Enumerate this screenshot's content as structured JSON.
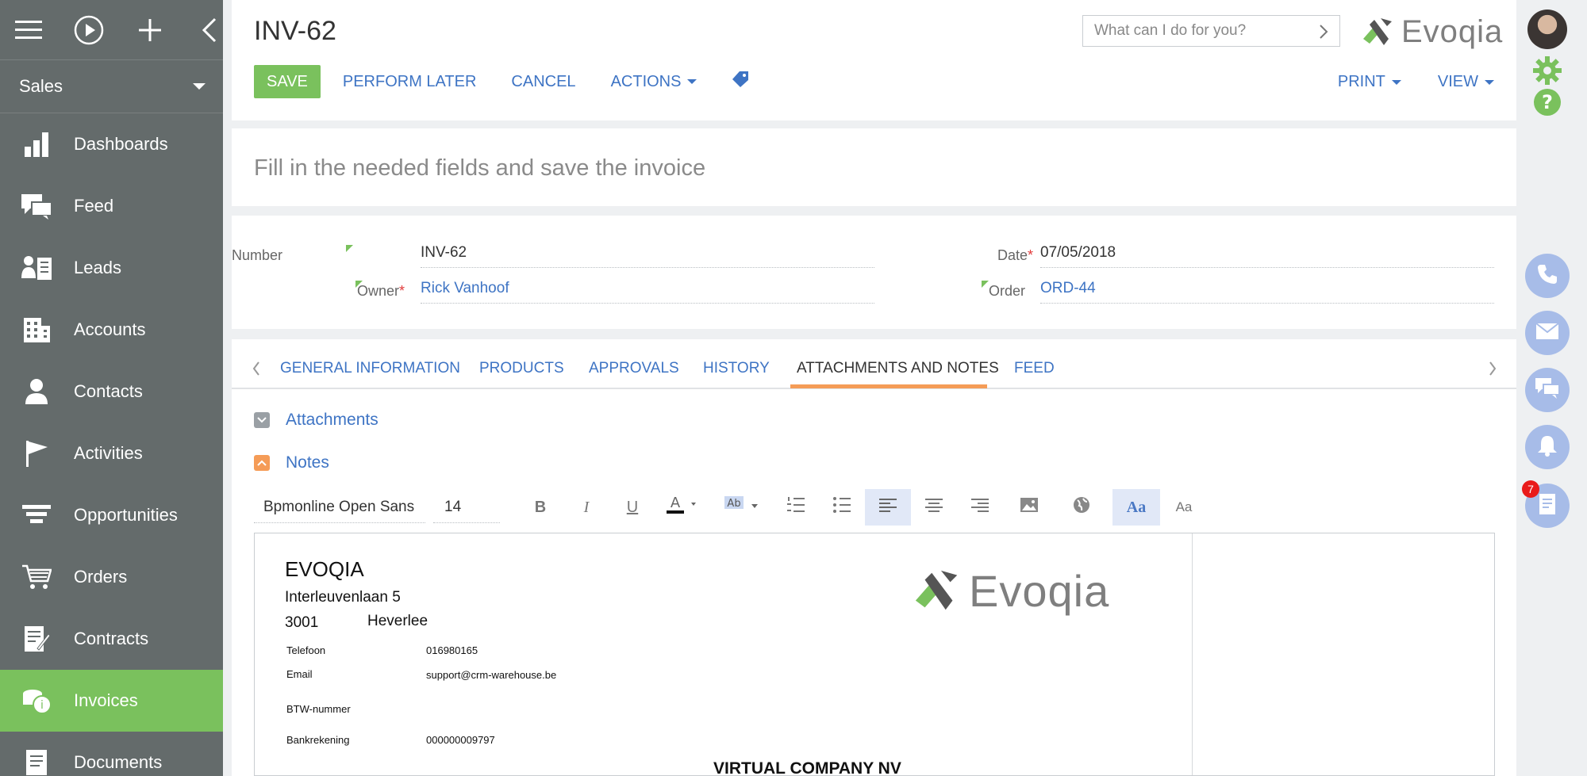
{
  "sidebar": {
    "workspace": "Sales",
    "items": [
      {
        "label": "Dashboards",
        "icon": "bar-chart-icon"
      },
      {
        "label": "Feed",
        "icon": "chat-bubbles-icon"
      },
      {
        "label": "Leads",
        "icon": "leads-icon"
      },
      {
        "label": "Accounts",
        "icon": "building-icon"
      },
      {
        "label": "Contacts",
        "icon": "person-icon"
      },
      {
        "label": "Activities",
        "icon": "flag-icon"
      },
      {
        "label": "Opportunities",
        "icon": "funnel-icon"
      },
      {
        "label": "Orders",
        "icon": "cart-icon"
      },
      {
        "label": "Contracts",
        "icon": "contract-icon"
      },
      {
        "label": "Invoices",
        "icon": "coins-icon"
      },
      {
        "label": "Documents",
        "icon": "document-icon"
      }
    ]
  },
  "header": {
    "title": "INV-62",
    "search_placeholder": "What can I do for you?",
    "logo_text": "Evoqia",
    "toolbar": {
      "save": "SAVE",
      "perform_later": "PERFORM LATER",
      "cancel": "CANCEL",
      "actions": "ACTIONS",
      "print": "PRINT",
      "view": "VIEW"
    }
  },
  "hint": "Fill in the needed fields and save the invoice",
  "fields": {
    "number_label": "Number",
    "number_value": "INV-62",
    "owner_label": "Owner",
    "owner_value": "Rick Vanhoof",
    "date_label": "Date",
    "date_value": "07/05/2018",
    "order_label": "Order",
    "order_value": "ORD-44",
    "required_mark": "*"
  },
  "tabs": [
    "GENERAL INFORMATION",
    "PRODUCTS",
    "APPROVALS",
    "HISTORY",
    "ATTACHMENTS AND NOTES",
    "FEED"
  ],
  "active_tab": "ATTACHMENTS AND NOTES",
  "sections": {
    "attachments": "Attachments",
    "notes": "Notes"
  },
  "editor_toolbar": {
    "font": "Bpmonline Open Sans",
    "size": "14"
  },
  "document": {
    "company": "EVOQIA",
    "street": "Interleuvenlaan 5",
    "postcode": "3001",
    "city": "Heverlee",
    "phone_label": "Telefoon",
    "phone_value": "016980165",
    "email_label": "Email",
    "email_value": "support@crm-warehouse.be",
    "vat_label": "BTW-nummer",
    "bank_label": "Bankrekening",
    "bank_value": "000000009797",
    "logo_text": "Evoqia",
    "customer": "VIRTUAL COMPANY NV"
  },
  "notifications_count": "7",
  "colors": {
    "brand_green": "#7ac15d",
    "link_blue": "#3e74c4",
    "sidebar_gray": "#646b6b",
    "tab_accent": "#f59c57",
    "comm_button": "#a7bce8"
  }
}
